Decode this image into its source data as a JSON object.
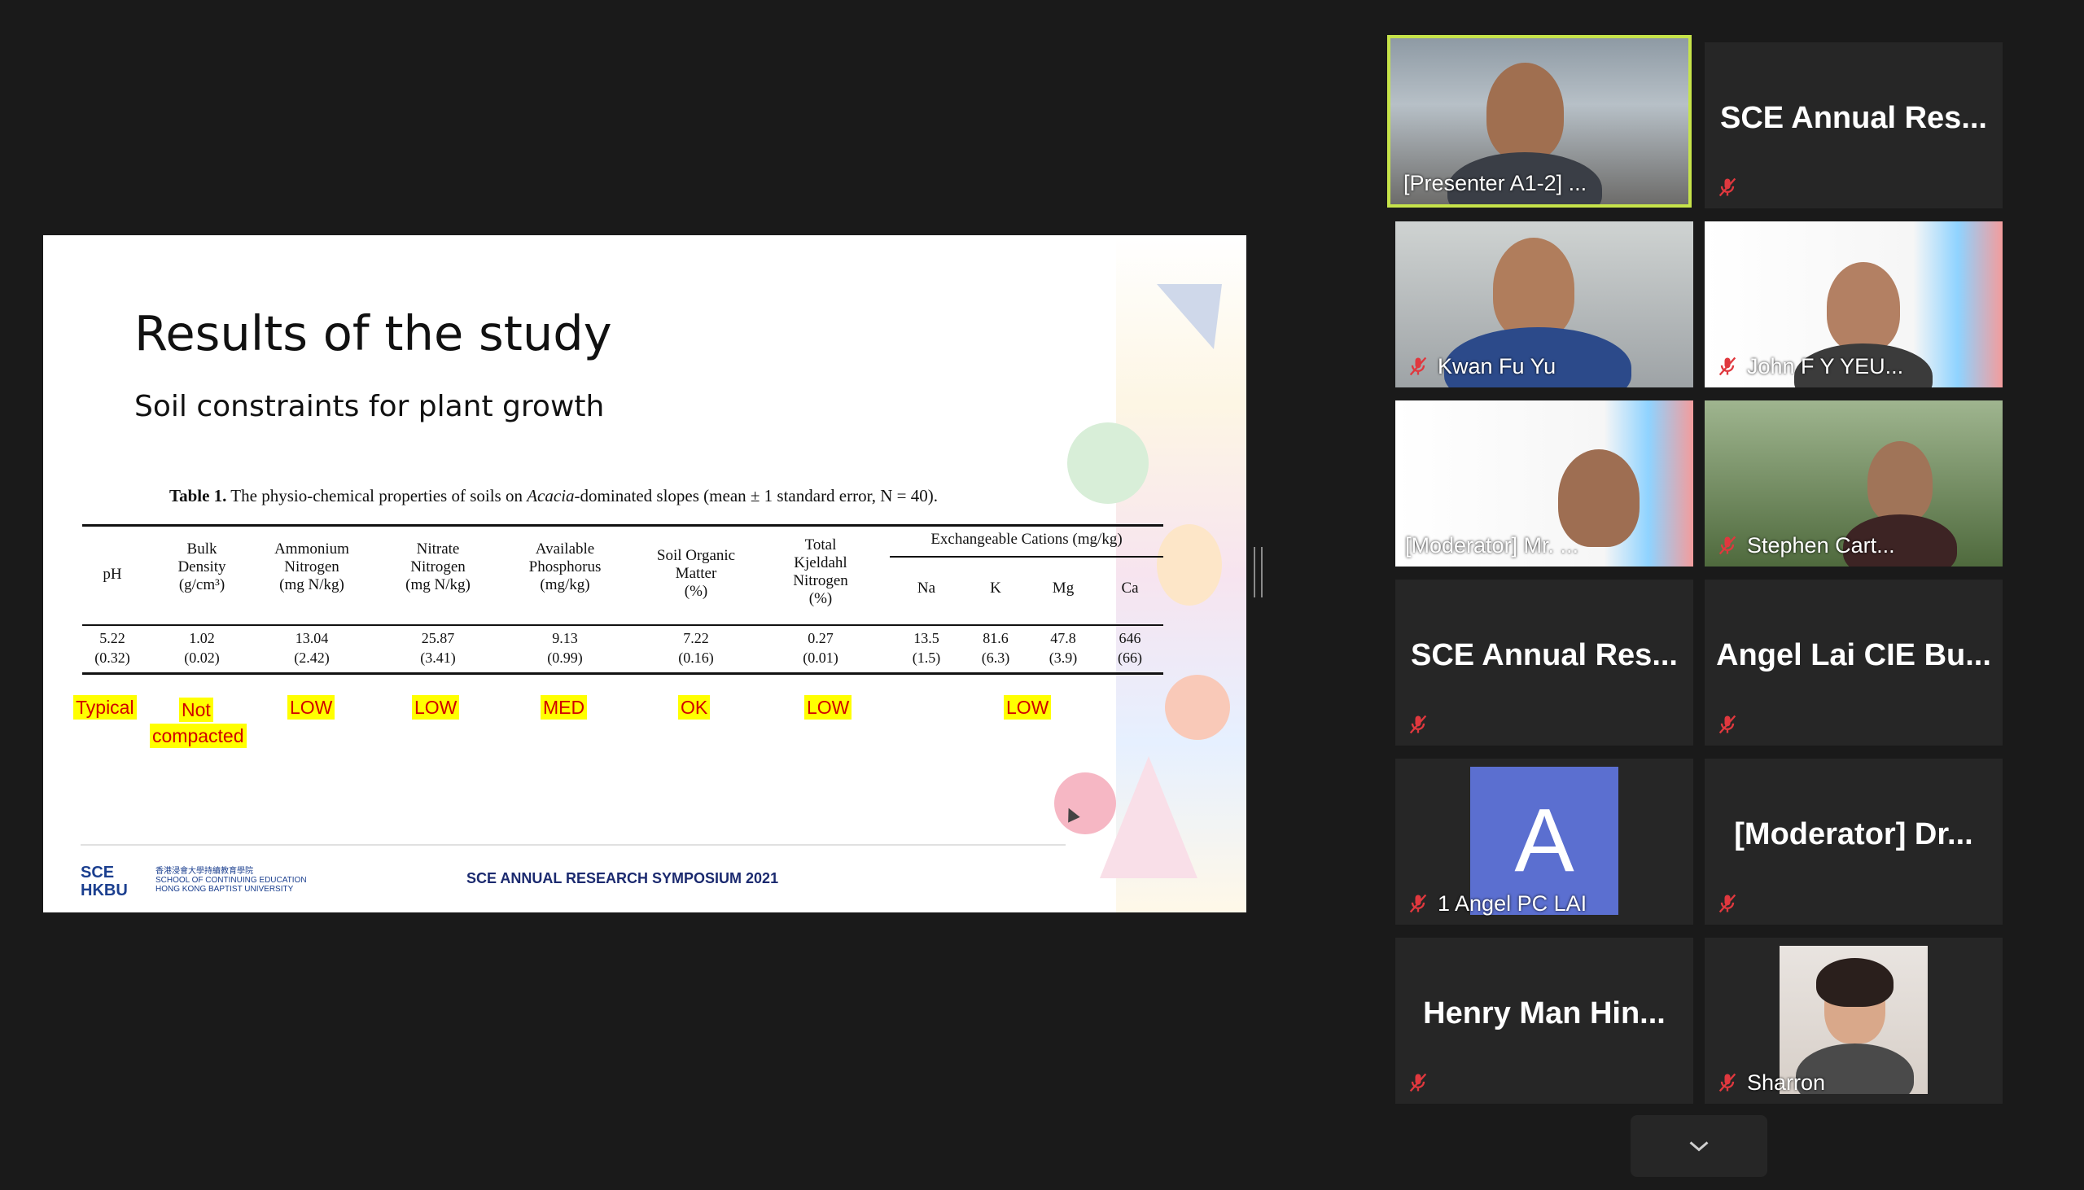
{
  "slide": {
    "title": "Results of the study",
    "subtitle": "Soil constraints for plant growth",
    "caption": {
      "label": "Table 1.",
      "pre": " The physio-chemical properties of soils on ",
      "species": "Acacia",
      "post": "-dominated slopes (mean ± 1 standard error, N = 40)."
    },
    "group_header": "Exchangeable Cations (mg/kg)",
    "columns": [
      {
        "h1": "pH",
        "h2": "",
        "h3": "",
        "h4": "",
        "mean": "5.22",
        "se": "(0.32)",
        "tag": "Typical"
      },
      {
        "h1": "Bulk",
        "h2": "Density",
        "h3": "(g/cm³)",
        "h4": "",
        "mean": "1.02",
        "se": "(0.02)",
        "tag": "Not compacted"
      },
      {
        "h1": "Ammonium",
        "h2": "Nitrogen",
        "h3": "(mg N/kg)",
        "h4": "",
        "mean": "13.04",
        "se": "(2.42)",
        "tag": "LOW"
      },
      {
        "h1": "Nitrate",
        "h2": "Nitrogen",
        "h3": "(mg N/kg)",
        "h4": "",
        "mean": "25.87",
        "se": "(3.41)",
        "tag": "LOW"
      },
      {
        "h1": "Available",
        "h2": "Phosphorus",
        "h3": "(mg/kg)",
        "h4": "",
        "mean": "9.13",
        "se": "(0.99)",
        "tag": "MED"
      },
      {
        "h1": "Soil Organic",
        "h2": "Matter",
        "h3": "(%)",
        "h4": "",
        "mean": "7.22",
        "se": "(0.16)",
        "tag": "OK"
      },
      {
        "h1": "Total",
        "h2": "Kjeldahl",
        "h3": "Nitrogen",
        "h4": "(%)",
        "mean": "0.27",
        "se": "(0.01)",
        "tag": "LOW"
      }
    ],
    "cations": [
      {
        "name": "Na",
        "mean": "13.5",
        "se": "(1.5)"
      },
      {
        "name": "K",
        "mean": "81.6",
        "se": "(6.3)"
      },
      {
        "name": "Mg",
        "mean": "47.8",
        "se": "(3.9)"
      },
      {
        "name": "Ca",
        "mean": "646",
        "se": "(66)"
      }
    ],
    "cations_tag": "LOW",
    "tag_not": "Not",
    "tag_compacted": "compacted",
    "logo_mark_1": "SCE",
    "logo_mark_2": "HKBU",
    "logo_text_1": "香港浸會大學持續教育學院",
    "logo_text_2": "SCHOOL OF CONTINUING EDUCATION",
    "logo_text_3": "HONG KONG BAPTIST UNIVERSITY",
    "symposium": "SCE ANNUAL RESEARCH SYMPOSIUM 2021"
  },
  "participants": [
    {
      "name": "[Presenter A1-2] ...",
      "type": "video",
      "active": true
    },
    {
      "name": "SCE Annual Res...",
      "type": "name"
    },
    {
      "name": "Kwan Fu Yu",
      "type": "video"
    },
    {
      "name": "John F Y YEU...",
      "type": "video"
    },
    {
      "name": "[Moderator] Mr. ...",
      "type": "video"
    },
    {
      "name": "Stephen Cart...",
      "type": "video"
    },
    {
      "name": "SCE Annual Res...",
      "type": "name"
    },
    {
      "name": "Angel Lai CIE Bu...",
      "type": "name"
    },
    {
      "name": "1 Angel PC LAI",
      "type": "avatar",
      "initial": "A"
    },
    {
      "name": "[Moderator] Dr...",
      "type": "name"
    },
    {
      "name": "Henry Man Hin...",
      "type": "name"
    },
    {
      "name": "Sharron",
      "type": "photo"
    }
  ],
  "icons": {
    "mic_muted": "mic-muted-icon",
    "more": "chevron-down-icon"
  },
  "colors": {
    "active_border": "#c6e34a",
    "tile_bg": "#262626",
    "highlight": "#ffff00",
    "highlight_text": "#d00000",
    "avatar_bg": "#5b6fd0",
    "mute_red": "#e0383e"
  }
}
